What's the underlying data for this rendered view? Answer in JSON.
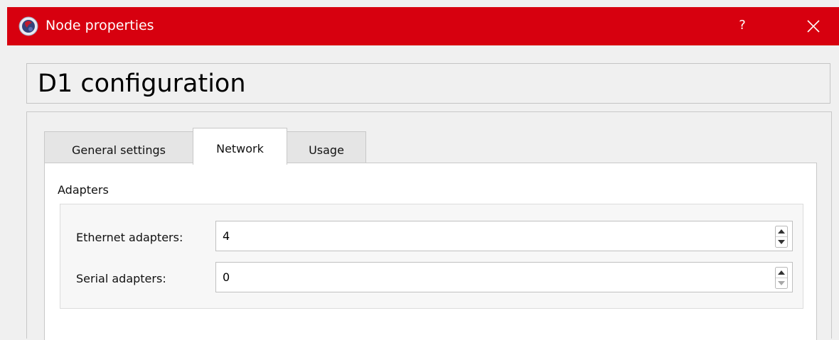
{
  "window": {
    "title": "Node properties",
    "help_label": "?",
    "icon": "gns3-app-icon",
    "close_icon": "close-icon",
    "titlebar_color": "#d7000f"
  },
  "header": {
    "title": "D1 configuration"
  },
  "tabs": [
    {
      "label": "General settings",
      "active": false
    },
    {
      "label": "Network",
      "active": true
    },
    {
      "label": "Usage",
      "active": false
    }
  ],
  "network": {
    "group_title": "Adapters",
    "fields": [
      {
        "label": "Ethernet adapters:",
        "value": "4"
      },
      {
        "label": "Serial adapters:",
        "value": "0"
      }
    ]
  }
}
